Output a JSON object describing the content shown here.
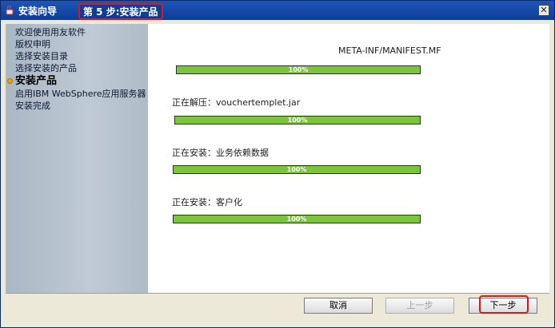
{
  "window": {
    "title": "安装向导",
    "step": "第 5 步:安装产品",
    "close_symbol": "✕"
  },
  "sidebar": {
    "items": [
      {
        "label": "欢迎使用用友软件",
        "current": false
      },
      {
        "label": "版权申明",
        "current": false
      },
      {
        "label": "选择安装目录",
        "current": false
      },
      {
        "label": "选择安装的产品",
        "current": false
      },
      {
        "label": "安装产品",
        "current": true
      },
      {
        "label": "启用IBM WebSphere应用服务器",
        "current": false
      },
      {
        "label": "安装完成",
        "current": false
      }
    ]
  },
  "progress": [
    {
      "label": "META-INF/MANIFEST.MF",
      "percent": 100,
      "text": "100%"
    },
    {
      "label": "正在解压：vouchertemplet.jar",
      "percent": 100,
      "text": "100%"
    },
    {
      "label": "正在安装：业务依赖数据",
      "percent": 100,
      "text": "100%"
    },
    {
      "label": "正在安装：客户化",
      "percent": 100,
      "text": "100%"
    }
  ],
  "buttons": {
    "cancel": "取消",
    "back": "上一步",
    "next": "下一步"
  },
  "colors": {
    "titlebar": "#0e3c96",
    "progress_fill": "#7cc43a",
    "highlight": "#e0161a",
    "bullet": "#e6a400"
  }
}
